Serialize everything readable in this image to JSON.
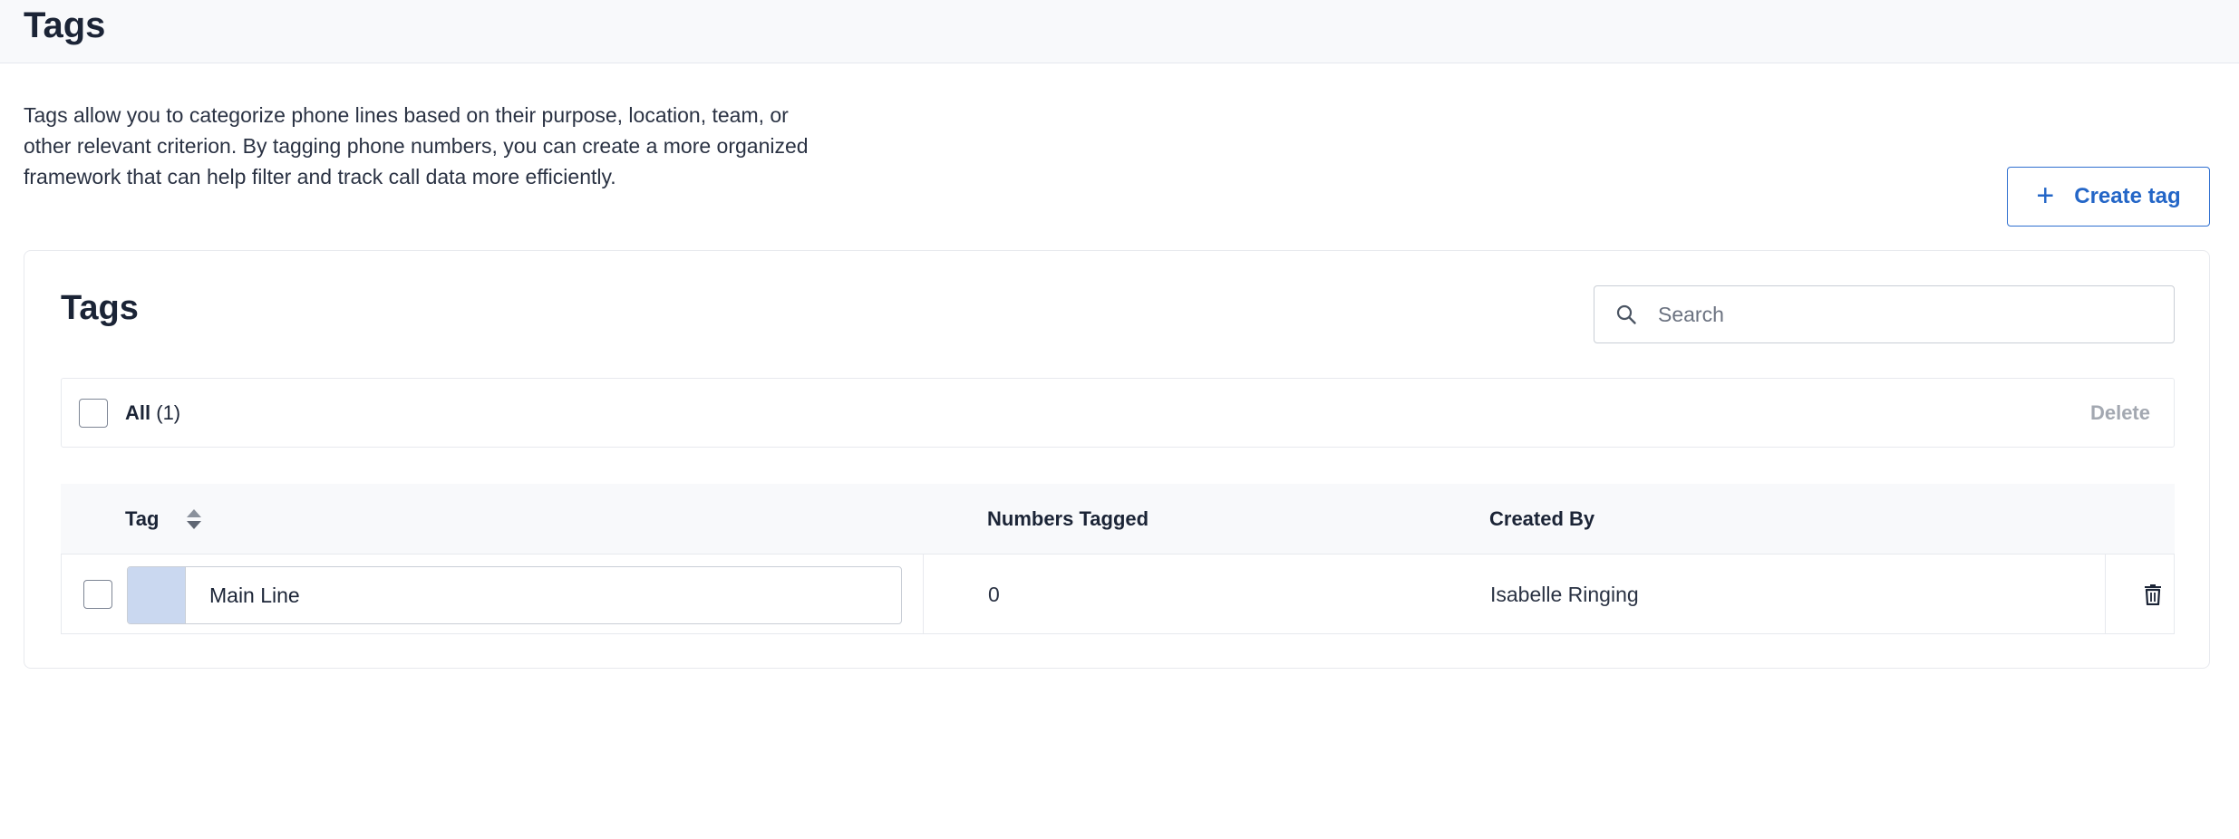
{
  "header": {
    "title": "Tags"
  },
  "description": "Tags allow you to categorize phone lines based on their purpose, location, team, or other relevant criterion. By tagging phone numbers, you can create a more organized framework that can help filter and track call data more efficiently.",
  "actions": {
    "create_label": "Create tag",
    "create_icon": "plus-icon"
  },
  "card": {
    "title": "Tags",
    "search": {
      "placeholder": "Search",
      "value": "",
      "icon": "search-icon"
    },
    "bulk": {
      "all_label": "All",
      "count": "(1)",
      "delete_label": "Delete"
    },
    "table": {
      "columns": [
        "Tag",
        "Numbers Tagged",
        "Created By"
      ],
      "rows": [
        {
          "tag": "Main Line",
          "color": "#cad8f0",
          "numbers_tagged": "0",
          "created_by": "Isabelle Ringing"
        }
      ]
    }
  },
  "colors": {
    "accent": "#2466c7",
    "header_bg": "#f8f9fb",
    "muted": "#a3a8b1"
  }
}
